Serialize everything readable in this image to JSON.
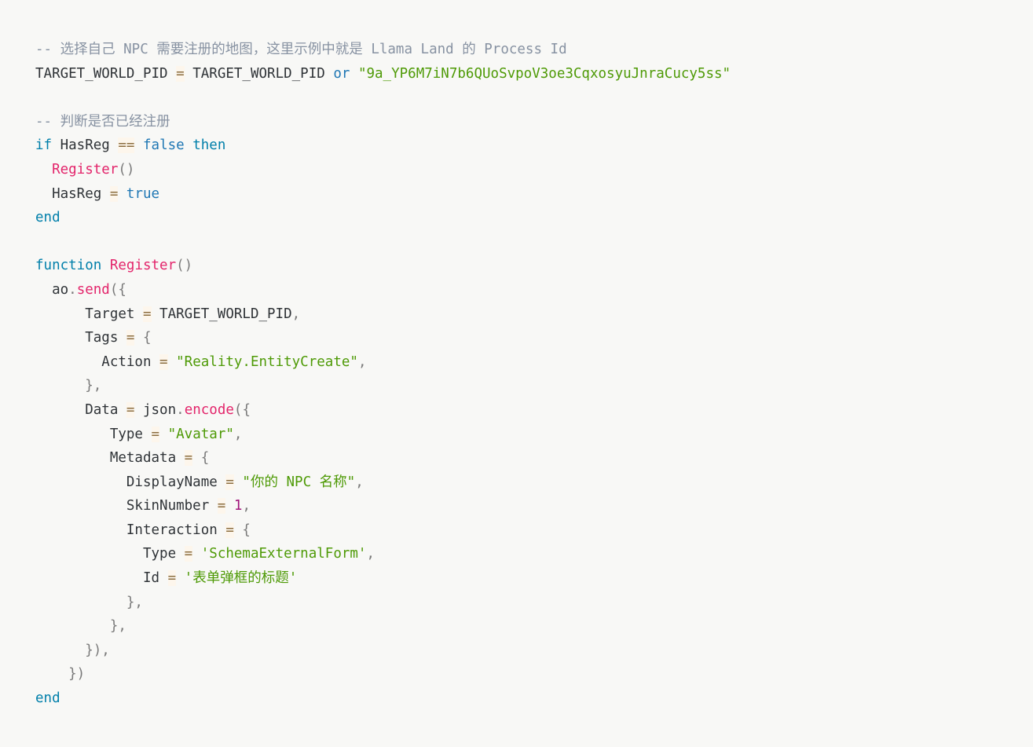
{
  "editor": {
    "language": "lua",
    "background_color": "#f8f8f6",
    "theme_colors": {
      "comment": "#8792a2",
      "keyword": "#007faa",
      "boolean": "#1f77b4",
      "function": "#e3256b",
      "string": "#4e9a06",
      "number": "#a0147a",
      "operator": "#8b6d3f",
      "name": "#2f3337",
      "punctuation": "#7a7a7a"
    }
  },
  "code": {
    "lines": [
      {
        "id": "line-1",
        "tokens": [
          {
            "text": "-- 选择自己 NPC 需要注册的地图，这里示例中就是 Llama Land 的 Process Id",
            "type": "comment"
          }
        ]
      },
      {
        "id": "line-2",
        "tokens": [
          {
            "text": "TARGET_WORLD_PID ",
            "type": "name"
          },
          {
            "text": "=",
            "type": "op"
          },
          {
            "text": " TARGET_WORLD_PID ",
            "type": "name"
          },
          {
            "text": "or",
            "type": "bool"
          },
          {
            "text": " ",
            "type": "plain"
          },
          {
            "text": "\"9a_YP6M7iN7b6QUoSvpoV3oe3CqxosyuJnraCucy5ss\"",
            "type": "string"
          }
        ]
      },
      {
        "id": "line-3",
        "tokens": []
      },
      {
        "id": "line-4",
        "tokens": [
          {
            "text": "-- 判断是否已经注册",
            "type": "comment"
          }
        ]
      },
      {
        "id": "line-5",
        "tokens": [
          {
            "text": "if",
            "type": "keyword"
          },
          {
            "text": " HasReg ",
            "type": "name"
          },
          {
            "text": "==",
            "type": "op"
          },
          {
            "text": " ",
            "type": "plain"
          },
          {
            "text": "false",
            "type": "bool"
          },
          {
            "text": " ",
            "type": "plain"
          },
          {
            "text": "then",
            "type": "keyword"
          }
        ]
      },
      {
        "id": "line-6",
        "tokens": [
          {
            "text": "  ",
            "type": "plain"
          },
          {
            "text": "Register",
            "type": "func"
          },
          {
            "text": "()",
            "type": "punc"
          }
        ]
      },
      {
        "id": "line-7",
        "tokens": [
          {
            "text": "  HasReg ",
            "type": "name"
          },
          {
            "text": "=",
            "type": "op"
          },
          {
            "text": " ",
            "type": "plain"
          },
          {
            "text": "true",
            "type": "bool"
          }
        ]
      },
      {
        "id": "line-8",
        "tokens": [
          {
            "text": "end",
            "type": "keyword"
          }
        ]
      },
      {
        "id": "line-9",
        "tokens": []
      },
      {
        "id": "line-10",
        "tokens": [
          {
            "text": "function",
            "type": "keyword"
          },
          {
            "text": " ",
            "type": "plain"
          },
          {
            "text": "Register",
            "type": "func"
          },
          {
            "text": "()",
            "type": "punc"
          }
        ]
      },
      {
        "id": "line-11",
        "tokens": [
          {
            "text": "  ao",
            "type": "name"
          },
          {
            "text": ".",
            "type": "punc"
          },
          {
            "text": "send",
            "type": "func"
          },
          {
            "text": "({",
            "type": "punc"
          }
        ]
      },
      {
        "id": "line-12",
        "tokens": [
          {
            "text": "      Target ",
            "type": "name"
          },
          {
            "text": "=",
            "type": "op"
          },
          {
            "text": " TARGET_WORLD_PID",
            "type": "name"
          },
          {
            "text": ",",
            "type": "punc"
          }
        ]
      },
      {
        "id": "line-13",
        "tokens": [
          {
            "text": "      Tags ",
            "type": "name"
          },
          {
            "text": "=",
            "type": "op"
          },
          {
            "text": " {",
            "type": "punc"
          }
        ]
      },
      {
        "id": "line-14",
        "tokens": [
          {
            "text": "        Action ",
            "type": "name"
          },
          {
            "text": "=",
            "type": "op"
          },
          {
            "text": " ",
            "type": "plain"
          },
          {
            "text": "\"Reality.EntityCreate\"",
            "type": "string"
          },
          {
            "text": ",",
            "type": "punc"
          }
        ]
      },
      {
        "id": "line-15",
        "tokens": [
          {
            "text": "      },",
            "type": "punc"
          }
        ]
      },
      {
        "id": "line-16",
        "tokens": [
          {
            "text": "      Data ",
            "type": "name"
          },
          {
            "text": "=",
            "type": "op"
          },
          {
            "text": " json",
            "type": "name"
          },
          {
            "text": ".",
            "type": "punc"
          },
          {
            "text": "encode",
            "type": "func"
          },
          {
            "text": "({",
            "type": "punc"
          }
        ]
      },
      {
        "id": "line-17",
        "tokens": [
          {
            "text": "         Type ",
            "type": "name"
          },
          {
            "text": "=",
            "type": "op"
          },
          {
            "text": " ",
            "type": "plain"
          },
          {
            "text": "\"Avatar\"",
            "type": "string"
          },
          {
            "text": ",",
            "type": "punc"
          }
        ]
      },
      {
        "id": "line-18",
        "tokens": [
          {
            "text": "         Metadata ",
            "type": "name"
          },
          {
            "text": "=",
            "type": "op"
          },
          {
            "text": " {",
            "type": "punc"
          }
        ]
      },
      {
        "id": "line-19",
        "tokens": [
          {
            "text": "           DisplayName ",
            "type": "name"
          },
          {
            "text": "=",
            "type": "op"
          },
          {
            "text": " ",
            "type": "plain"
          },
          {
            "text": "\"你的 NPC 名称\"",
            "type": "string"
          },
          {
            "text": ",",
            "type": "punc"
          }
        ]
      },
      {
        "id": "line-20",
        "tokens": [
          {
            "text": "           SkinNumber ",
            "type": "name"
          },
          {
            "text": "=",
            "type": "op"
          },
          {
            "text": " ",
            "type": "plain"
          },
          {
            "text": "1",
            "type": "number"
          },
          {
            "text": ",",
            "type": "punc"
          }
        ]
      },
      {
        "id": "line-21",
        "tokens": [
          {
            "text": "           Interaction ",
            "type": "name"
          },
          {
            "text": "=",
            "type": "op"
          },
          {
            "text": " {",
            "type": "punc"
          }
        ]
      },
      {
        "id": "line-22",
        "tokens": [
          {
            "text": "             Type ",
            "type": "name"
          },
          {
            "text": "=",
            "type": "op"
          },
          {
            "text": " ",
            "type": "plain"
          },
          {
            "text": "'SchemaExternalForm'",
            "type": "string"
          },
          {
            "text": ",",
            "type": "punc"
          }
        ]
      },
      {
        "id": "line-23",
        "tokens": [
          {
            "text": "             Id ",
            "type": "name"
          },
          {
            "text": "=",
            "type": "op"
          },
          {
            "text": " ",
            "type": "plain"
          },
          {
            "text": "'表单弹框的标题'",
            "type": "string"
          }
        ]
      },
      {
        "id": "line-24",
        "tokens": [
          {
            "text": "           },",
            "type": "punc"
          }
        ]
      },
      {
        "id": "line-25",
        "tokens": [
          {
            "text": "         },",
            "type": "punc"
          }
        ]
      },
      {
        "id": "line-26",
        "tokens": [
          {
            "text": "      }),",
            "type": "punc"
          }
        ]
      },
      {
        "id": "line-27",
        "tokens": [
          {
            "text": "    })",
            "type": "punc"
          }
        ]
      },
      {
        "id": "line-28",
        "tokens": [
          {
            "text": "end",
            "type": "keyword"
          }
        ]
      }
    ]
  }
}
